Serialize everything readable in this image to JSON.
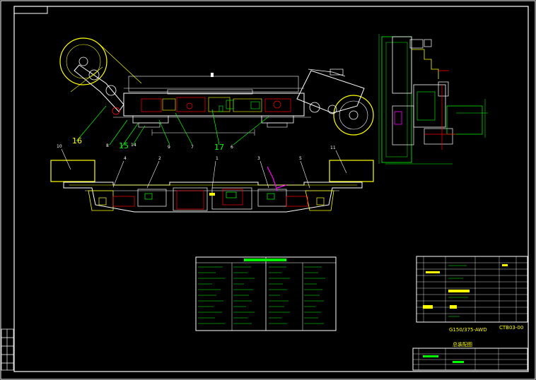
{
  "callouts_lower": [
    "10",
    "11",
    "4",
    "2",
    "1",
    "3",
    "5"
  ],
  "callouts_upper": [
    "16",
    "8",
    "15",
    "14",
    "9",
    "7",
    "17",
    "6"
  ],
  "title_block": {
    "drawing_code": "CTB03-00",
    "model": "G150/375-AWD",
    "title": "总装配图"
  },
  "colors": {
    "background": "#000000",
    "frame": "#ffffff",
    "primary": "#ffff00",
    "secondary": "#00ff00",
    "accent_red": "#ff0000",
    "accent_magenta": "#ff00ff"
  }
}
